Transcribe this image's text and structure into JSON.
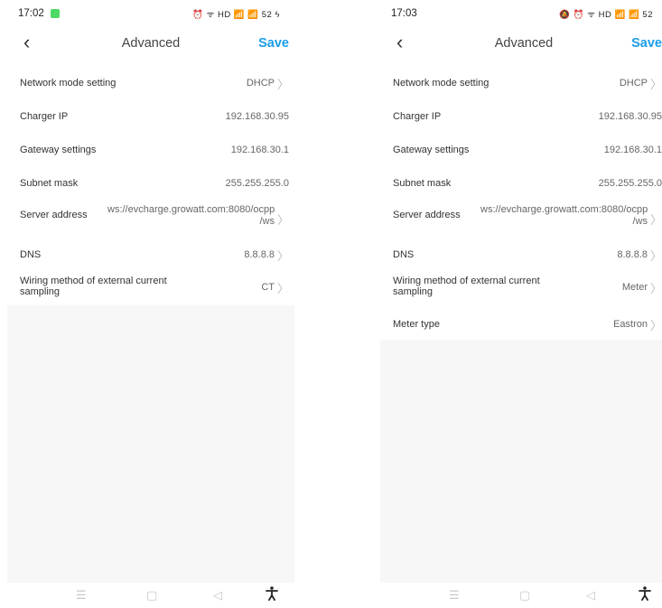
{
  "left": {
    "status": {
      "time": "17:02",
      "icons": "⏰ ᯤ HD 📶 📶 52 ϟ"
    },
    "header": {
      "back": "‹",
      "title": "Advanced",
      "save": "Save"
    },
    "rows": [
      {
        "label": "Network mode setting",
        "value": "DHCP",
        "chevron": true
      },
      {
        "label": "Charger IP",
        "value": "192.168.30.95",
        "chevron": false
      },
      {
        "label": "Gateway settings",
        "value": "192.168.30.1",
        "chevron": false
      },
      {
        "label": "Subnet mask",
        "value": "255.255.255.0",
        "chevron": false
      },
      {
        "label": "Server address",
        "value": "ws://evcharge.growatt.com:8080/ocpp /ws",
        "chevron": true
      },
      {
        "label": "DNS",
        "value": "8.8.8.8",
        "chevron": true
      },
      {
        "label": "Wiring method of external current sampling",
        "value": "CT",
        "chevron": true
      }
    ],
    "nav": {
      "menu": "☰",
      "home": "▢",
      "back": "◁",
      "accessibility": "accessibility-icon"
    }
  },
  "right": {
    "status": {
      "time": "17:03",
      "icons": "🔕 ⏰ ᯤ HD 📶 📶 52"
    },
    "header": {
      "back": "‹",
      "title": "Advanced",
      "save": "Save"
    },
    "rows": [
      {
        "label": "Network mode setting",
        "value": "DHCP",
        "chevron": true
      },
      {
        "label": "Charger IP",
        "value": "192.168.30.95",
        "chevron": false
      },
      {
        "label": "Gateway settings",
        "value": "192.168.30.1",
        "chevron": false
      },
      {
        "label": "Subnet mask",
        "value": "255.255.255.0",
        "chevron": false
      },
      {
        "label": "Server address",
        "value": "ws://evcharge.growatt.com:8080/ocpp /ws",
        "chevron": true
      },
      {
        "label": "DNS",
        "value": "8.8.8.8",
        "chevron": true
      },
      {
        "label": "Wiring method of external current sampling",
        "value": "Meter",
        "chevron": true
      },
      {
        "label": "Meter type",
        "value": "Eastron",
        "chevron": true
      }
    ],
    "nav": {
      "menu": "☰",
      "home": "▢",
      "back": "◁",
      "accessibility": "accessibility-icon"
    }
  },
  "colors": {
    "accent": "#1b9ee8",
    "background": "#ffffff",
    "empty_area": "#f7f7f7"
  }
}
